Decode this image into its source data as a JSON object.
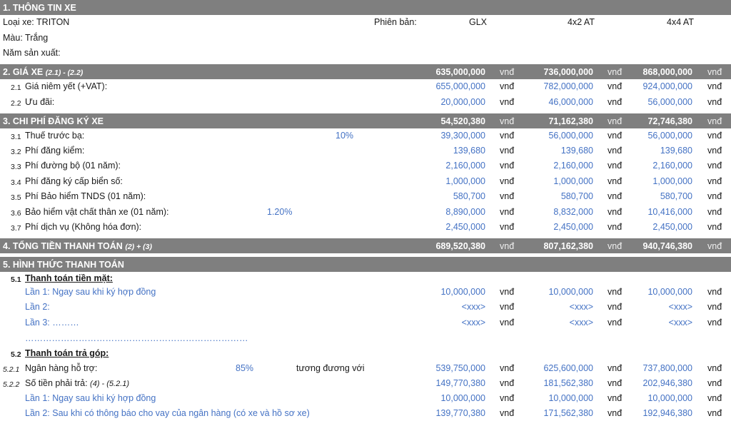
{
  "s1": {
    "title": "1. THÔNG TIN XE",
    "model": "Loại xe: TRITON",
    "version_label": "Phiên bản:",
    "versions": [
      "GLX",
      "4x2 AT",
      "4x4 AT"
    ],
    "color": "Màu: Trắng",
    "year": "Năm sản xuất:"
  },
  "s2": {
    "title": "2. GIÁ XE",
    "title_note": "(2.1) - (2.2)",
    "totals": [
      "635,000,000",
      "736,000,000",
      "868,000,000"
    ],
    "rows": [
      {
        "no": "2.1",
        "label": "Giá niêm yết (+VAT):",
        "v": [
          "655,000,000",
          "782,000,000",
          "924,000,000"
        ]
      },
      {
        "no": "2.2",
        "label": "Ưu đãi:",
        "v": [
          "20,000,000",
          "46,000,000",
          "56,000,000"
        ]
      }
    ]
  },
  "s3": {
    "title": "3. CHI PHÍ ĐĂNG KÝ XE",
    "totals": [
      "54,520,380",
      "71,162,380",
      "72,746,380"
    ],
    "rows": [
      {
        "no": "3.1",
        "label": "Thuế trước bạ:",
        "rate": "10%",
        "v": [
          "39,300,000",
          "56,000,000",
          "56,000,000"
        ]
      },
      {
        "no": "3.2",
        "label": "Phí đăng kiểm:",
        "rate": "",
        "v": [
          "139,680",
          "139,680",
          "139,680"
        ]
      },
      {
        "no": "3.3",
        "label": "Phí đường bộ (01 năm):",
        "rate": "",
        "v": [
          "2,160,000",
          "2,160,000",
          "2,160,000"
        ]
      },
      {
        "no": "3.4",
        "label": "Phí đăng ký cấp biển số:",
        "rate": "",
        "v": [
          "1,000,000",
          "1,000,000",
          "1,000,000"
        ]
      },
      {
        "no": "3.5",
        "label": "Phí Bảo hiểm TNDS (01 năm):",
        "rate": "",
        "v": [
          "580,700",
          "580,700",
          "580,700"
        ]
      },
      {
        "no": "3.6",
        "label": "Bảo hiểm vật chất thân xe (01 năm):",
        "rate": "1.20%",
        "v": [
          "8,890,000",
          "8,832,000",
          "10,416,000"
        ]
      },
      {
        "no": "3.7",
        "label": "Phí dịch vụ (Không hóa đơn):",
        "rate": "",
        "v": [
          "2,450,000",
          "2,450,000",
          "2,450,000"
        ]
      }
    ]
  },
  "s4": {
    "title": "4. TỔNG TIỀN THANH TOÁN",
    "title_note": "(2) + (3)",
    "totals": [
      "689,520,380",
      "807,162,380",
      "940,746,380"
    ]
  },
  "s5": {
    "title": "5. HÌNH THỨC THANH TOÁN",
    "cash_no": "5.1",
    "cash_title": "Thanh toán tiền mặt:",
    "cash_rows": [
      {
        "label": "Lần 1: Ngay sau khi ký hợp đồng",
        "v": [
          "10,000,000",
          "10,000,000",
          "10,000,000"
        ]
      },
      {
        "label": "Lần 2:",
        "v": [
          "<xxx>",
          "<xxx>",
          "<xxx>"
        ]
      },
      {
        "label": "Lần 3: ………",
        "v": [
          "<xxx>",
          "<xxx>",
          "<xxx>"
        ]
      }
    ],
    "cash_dots": "…………………………………………………………………",
    "loan_no": "5.2",
    "loan_title": "Thanh toán trả góp:",
    "bank": {
      "no": "5.2.1",
      "label": "Ngân hàng hỗ trợ:",
      "rate": "85%",
      "equiv": "tương đương với",
      "v": [
        "539,750,000",
        "625,600,000",
        "737,800,000"
      ]
    },
    "pay": {
      "no": "5.2.2",
      "label": "Số tiền phải trả:",
      "note": "(4) - (5.2.1)",
      "v": [
        "149,770,380",
        "181,562,380",
        "202,946,380"
      ]
    },
    "pay_rows": [
      {
        "label": "Lần 1: Ngay sau khi ký hợp đồng",
        "v": [
          "10,000,000",
          "10,000,000",
          "10,000,000"
        ]
      },
      {
        "label": "Lần 2: Sau khi có thông báo cho vay của ngân hàng (có xe và hồ sơ xe)",
        "v": [
          "139,770,380",
          "171,562,380",
          "192,946,380"
        ]
      }
    ]
  },
  "currency": "vnđ"
}
